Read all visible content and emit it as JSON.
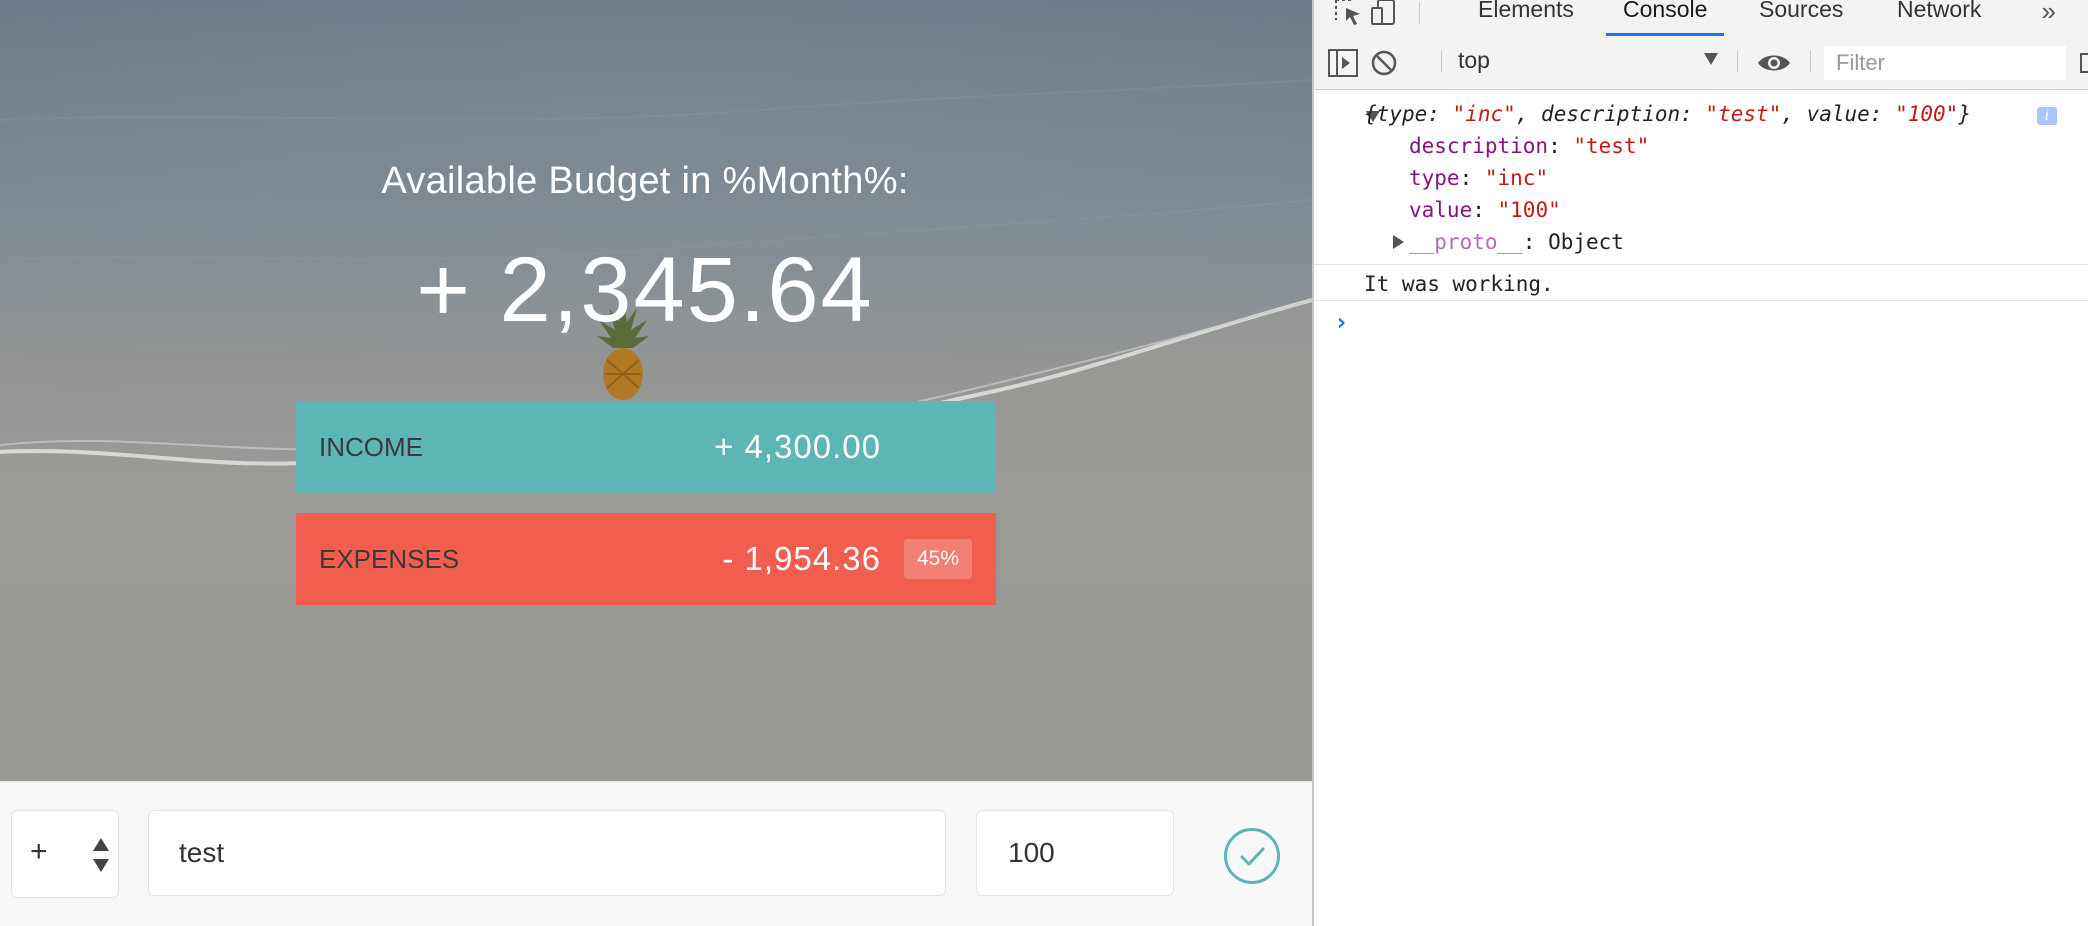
{
  "app": {
    "budget_title": "Available Budget in %Month%:",
    "budget_value": "+ 2,345.64",
    "income": {
      "label": "INCOME",
      "value": "+ 4,300.00"
    },
    "expenses": {
      "label": "EXPENSES",
      "value": "- 1,954.36",
      "percentage": "45%"
    },
    "add": {
      "type_value": "+",
      "description_value": "test",
      "value_value": "100"
    },
    "colors": {
      "income": "#5cb6b6",
      "expenses": "#f15e50",
      "accent": "#5cb6b6"
    }
  },
  "devtools": {
    "tabs": [
      "Elements",
      "Console",
      "Sources",
      "Network"
    ],
    "active_tab": "Console",
    "more_tabs": "»",
    "context": "top",
    "filter_placeholder": "Filter",
    "console": {
      "object_summary": {
        "k1": "type",
        "v1": "\"inc\"",
        "k2": "description",
        "v2": "\"test\"",
        "k3": "value",
        "v3": "\"100\""
      },
      "props": [
        {
          "key": "description",
          "value": "\"test\""
        },
        {
          "key": "type",
          "value": "\"inc\""
        },
        {
          "key": "value",
          "value": "\"100\""
        }
      ],
      "proto_key": "__proto__",
      "proto_value": ": Object",
      "info_badge": "i",
      "log_message": "It was working.",
      "prompt_symbol": "›"
    }
  }
}
